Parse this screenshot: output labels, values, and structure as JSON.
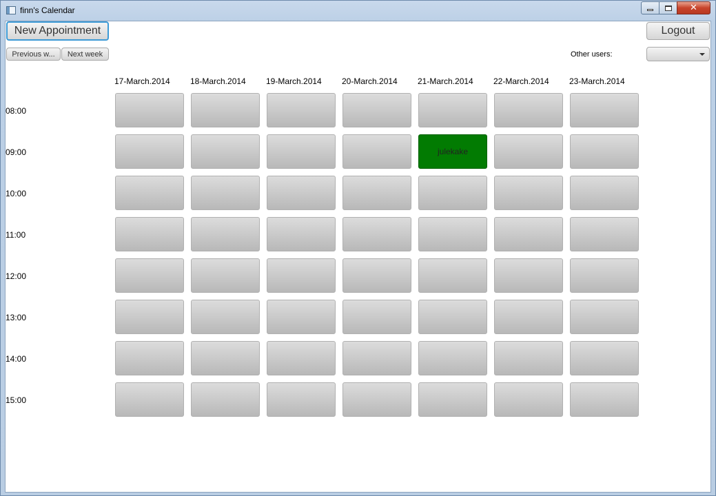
{
  "window": {
    "title": "finn's Calendar"
  },
  "toolbar": {
    "new_appointment_label": "New Appointment",
    "logout_label": "Logout",
    "previous_week_label": "Previous w...",
    "next_week_label": "Next week",
    "other_users_label": "Other users:",
    "other_users_selected": ""
  },
  "calendar": {
    "days": [
      "17-March.2014",
      "18-March.2014",
      "19-March.2014",
      "20-March.2014",
      "21-March.2014",
      "22-March.2014",
      "23-March.2014"
    ],
    "hours": [
      "08:00",
      "09:00",
      "10:00",
      "11:00",
      "12:00",
      "13:00",
      "14:00",
      "15:00"
    ],
    "appointments": [
      {
        "day": "21-March.2014",
        "hour": "09:00",
        "title": "julekake",
        "color": "#027b02"
      }
    ]
  },
  "colors": {
    "accent": "#3d9ad6",
    "appointment": "#027b02",
    "slot": "#c8c8c8"
  }
}
